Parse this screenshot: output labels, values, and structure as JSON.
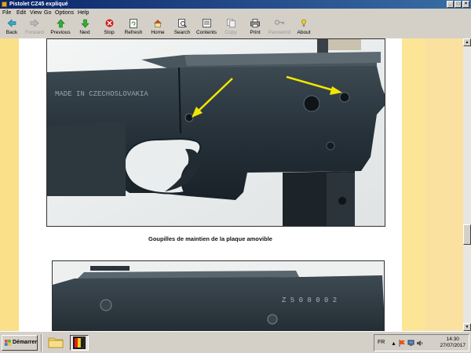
{
  "window": {
    "title": "Pistolet CZ45 expliqué",
    "controls": [
      "minimize",
      "maximize",
      "close"
    ]
  },
  "menu": [
    "File",
    "Edit",
    "View",
    "Go",
    "Options",
    "Help"
  ],
  "toolbar": [
    {
      "label": "Back",
      "icon": "back-arrow-icon",
      "enabled": true
    },
    {
      "label": "Forward",
      "icon": "forward-arrow-icon",
      "enabled": false
    },
    {
      "label": "Previous",
      "icon": "up-arrow-icon",
      "enabled": true
    },
    {
      "label": "Next",
      "icon": "down-arrow-icon",
      "enabled": true
    },
    {
      "label": "Stop",
      "icon": "stop-icon",
      "enabled": true
    },
    {
      "label": "Refresh",
      "icon": "refresh-icon",
      "enabled": true
    },
    {
      "label": "Home",
      "icon": "home-icon",
      "enabled": true
    },
    {
      "label": "Search",
      "icon": "search-icon",
      "enabled": true
    },
    {
      "label": "Contents",
      "icon": "contents-icon",
      "enabled": true
    },
    {
      "label": "Copy",
      "icon": "copy-icon",
      "enabled": false
    },
    {
      "label": "Print",
      "icon": "print-icon",
      "enabled": true
    },
    {
      "label": "Password",
      "icon": "key-icon",
      "enabled": false
    },
    {
      "label": "About",
      "icon": "about-icon",
      "enabled": true
    }
  ],
  "document": {
    "photo1_engraving": "MADE IN CZECHOSLOVAKIA",
    "caption": "Goupilles de maintien de la plaque amovible",
    "photo2_serial": "Z 5 0 8 0 0 2"
  },
  "taskbar": {
    "start_label": "Démarrer",
    "language": "FR",
    "time": "14:30",
    "date": "27/07/2017"
  },
  "colors": {
    "title_bar": "#0a246a",
    "content_background": "#fde8a0",
    "annotation_arrow": "#f2e600"
  }
}
